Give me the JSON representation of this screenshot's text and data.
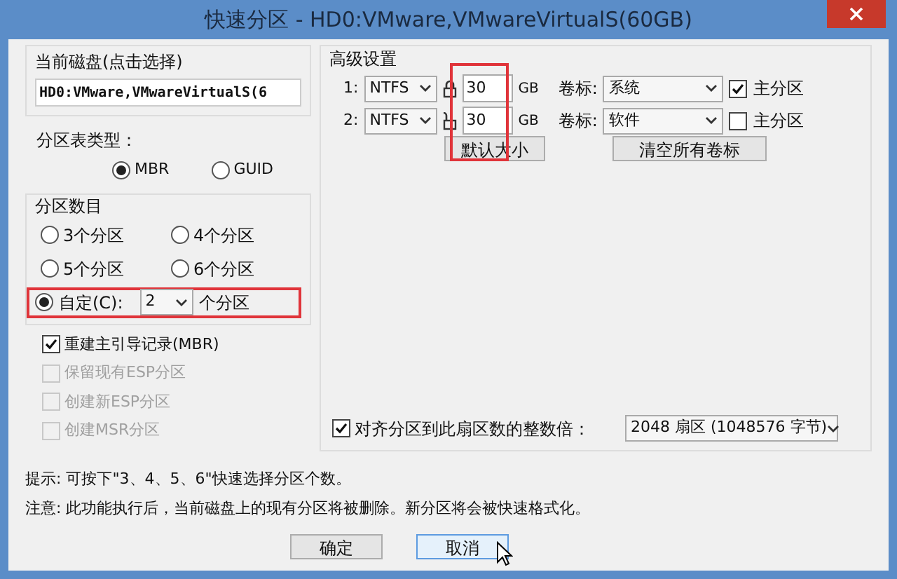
{
  "window": {
    "title": "快速分区 - HD0:VMware,VMwareVirtualS(60GB)"
  },
  "disk": {
    "caption": "当前磁盘(点击选择)",
    "value": "HD0:VMware,VMwareVirtualS(6"
  },
  "table_type": {
    "caption": "分区表类型：",
    "options": [
      {
        "label": "MBR",
        "selected": true
      },
      {
        "label": "GUID",
        "selected": false
      }
    ]
  },
  "count": {
    "caption": "分区数目",
    "options": [
      {
        "label": "3个分区",
        "selected": false
      },
      {
        "label": "4个分区",
        "selected": false
      },
      {
        "label": "5个分区",
        "selected": false
      },
      {
        "label": "6个分区",
        "selected": false
      }
    ],
    "custom": {
      "label": "自定(C):",
      "selected": true,
      "value": "2",
      "suffix": "个分区"
    }
  },
  "options": [
    {
      "label": "重建主引导记录(MBR)",
      "checked": true,
      "disabled": false
    },
    {
      "label": "保留现有ESP分区",
      "checked": false,
      "disabled": true
    },
    {
      "label": "创建新ESP分区",
      "checked": false,
      "disabled": true
    },
    {
      "label": "创建MSR分区",
      "checked": false,
      "disabled": true
    }
  ],
  "advanced": {
    "caption": "高级设置",
    "partitions": [
      {
        "index": "1:",
        "fs": "NTFS",
        "locked": true,
        "size": "30",
        "unit": "GB",
        "volume_caption": "卷标:",
        "volume": "系统",
        "primary_label": "主分区",
        "primary": true
      },
      {
        "index": "2:",
        "fs": "NTFS",
        "locked": false,
        "size": "30",
        "unit": "GB",
        "volume_caption": "卷标:",
        "volume": "软件",
        "primary_label": "主分区",
        "primary": false
      }
    ],
    "buttons": [
      "默认大小",
      "清空所有卷标"
    ],
    "align": {
      "label": "对齐分区到此扇区数的整数倍：",
      "checked": true,
      "value": "2048 扇区 (1048576 字节)"
    }
  },
  "hints": [
    "提示: 可按下\"3、4、5、6\"快速选择分区个数。",
    "注意: 此功能执行后，当前磁盘上的现有分区将被删除。新分区将会被快速格式化。"
  ],
  "buttons": [
    "确定",
    "取消"
  ]
}
